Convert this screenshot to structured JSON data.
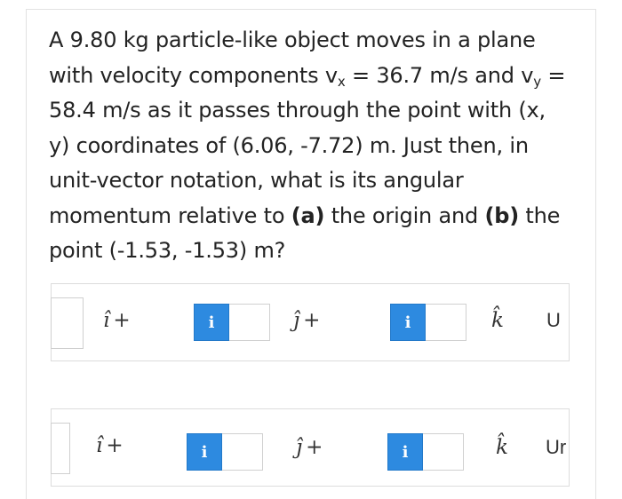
{
  "question": {
    "line1": "A 9.80 kg particle-like object moves in a plane",
    "line2_pre": "with velocity components v",
    "vx_sub": "x",
    "line2_mid": " = 36.7 m/s and v",
    "vy_sub": "y",
    "line2_post": " =",
    "line3": "58.4 m/s as it passes through the point with (x,",
    "line4": "y) coordinates of (6.06, -7.72) m. Just then, in",
    "line5": "unit-vector notation, what is its angular",
    "line6_pre": "momentum relative to ",
    "part_a": "(a)",
    "line6_mid": " the origin and ",
    "part_b": "(b)",
    "line6_post": " the",
    "line7": "point (-1.53, -1.53) m?"
  },
  "answers": [
    {
      "i_hat": "î",
      "plus1": "+",
      "info1": "i",
      "j_hat": "ĵ",
      "plus2": "+",
      "info2": "i",
      "k_hat": "k̂",
      "units": "U"
    },
    {
      "i_hat": "î",
      "plus1": "+",
      "info1": "i",
      "j_hat": "ĵ",
      "plus2": "+",
      "info2": "i",
      "k_hat": "k̂",
      "units": "Ur"
    }
  ],
  "colors": {
    "info_button": "#2d8ae0",
    "text": "#232323",
    "border": "#dcdcdc"
  }
}
